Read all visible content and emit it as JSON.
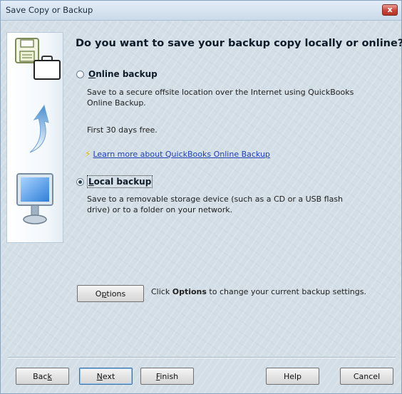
{
  "window": {
    "title": "Save Copy or Backup",
    "close_label": "x"
  },
  "heading": "Do you want to save your backup copy locally or online?",
  "options": [
    {
      "label_prefix": "O",
      "label_rest": "nline backup",
      "selected": false,
      "description": "Save to a secure offsite location over the Internet using QuickBooks Online Backup.",
      "extra": "First 30 days free.",
      "link_text": "Learn more about QuickBooks Online Backup"
    },
    {
      "label_prefix": "L",
      "label_rest": "ocal backup",
      "selected": true,
      "description": "Save to a removable storage device (such as a CD or a USB flash drive) or to a folder on your network."
    }
  ],
  "options_button": {
    "pre": "O",
    "accel": "p",
    "post": "tions"
  },
  "options_note": {
    "pre": "Click ",
    "bold": "Options",
    "post": " to change your current backup settings."
  },
  "footer_buttons": {
    "back": {
      "pre": "Bac",
      "accel": "k",
      "post": ""
    },
    "next": {
      "pre": "",
      "accel": "N",
      "post": "ext"
    },
    "finish": {
      "pre": "",
      "accel": "F",
      "post": "inish"
    },
    "help": {
      "label": "Help"
    },
    "cancel": {
      "label": "Cancel"
    }
  },
  "icons": {
    "floppy": "floppy-disk-icon",
    "briefcase": "briefcase-icon",
    "arrow": "curved-arrow-icon",
    "monitor": "computer-monitor-icon",
    "bolt": "lightning-bolt-icon"
  }
}
